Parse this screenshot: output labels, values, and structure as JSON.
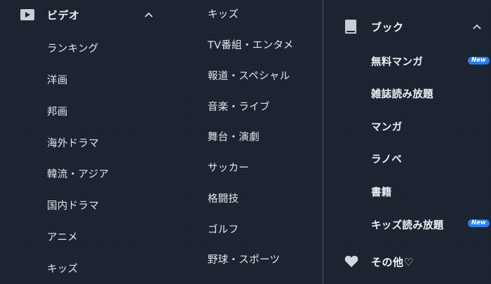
{
  "video": {
    "title": "ビデオ",
    "items": [
      "ランキング",
      "洋画",
      "邦画",
      "海外ドラマ",
      "韓流・アジア",
      "国内ドラマ",
      "アニメ",
      "キッズ"
    ],
    "items2": [
      "キッズ",
      "TV番組・エンタメ",
      "報道・スペシャル",
      "音楽・ライブ",
      "舞台・演劇",
      "サッカー",
      "格闘技",
      "ゴルフ",
      "野球・スポーツ"
    ]
  },
  "book": {
    "title": "ブック",
    "items": [
      {
        "label": "無料マンガ",
        "badge": "New"
      },
      {
        "label": "雑誌読み放題"
      },
      {
        "label": "マンガ"
      },
      {
        "label": "ラノベ"
      },
      {
        "label": "書籍"
      },
      {
        "label": "キッズ読み放題",
        "badge": "New"
      }
    ]
  },
  "other": {
    "title": "その他♡"
  }
}
